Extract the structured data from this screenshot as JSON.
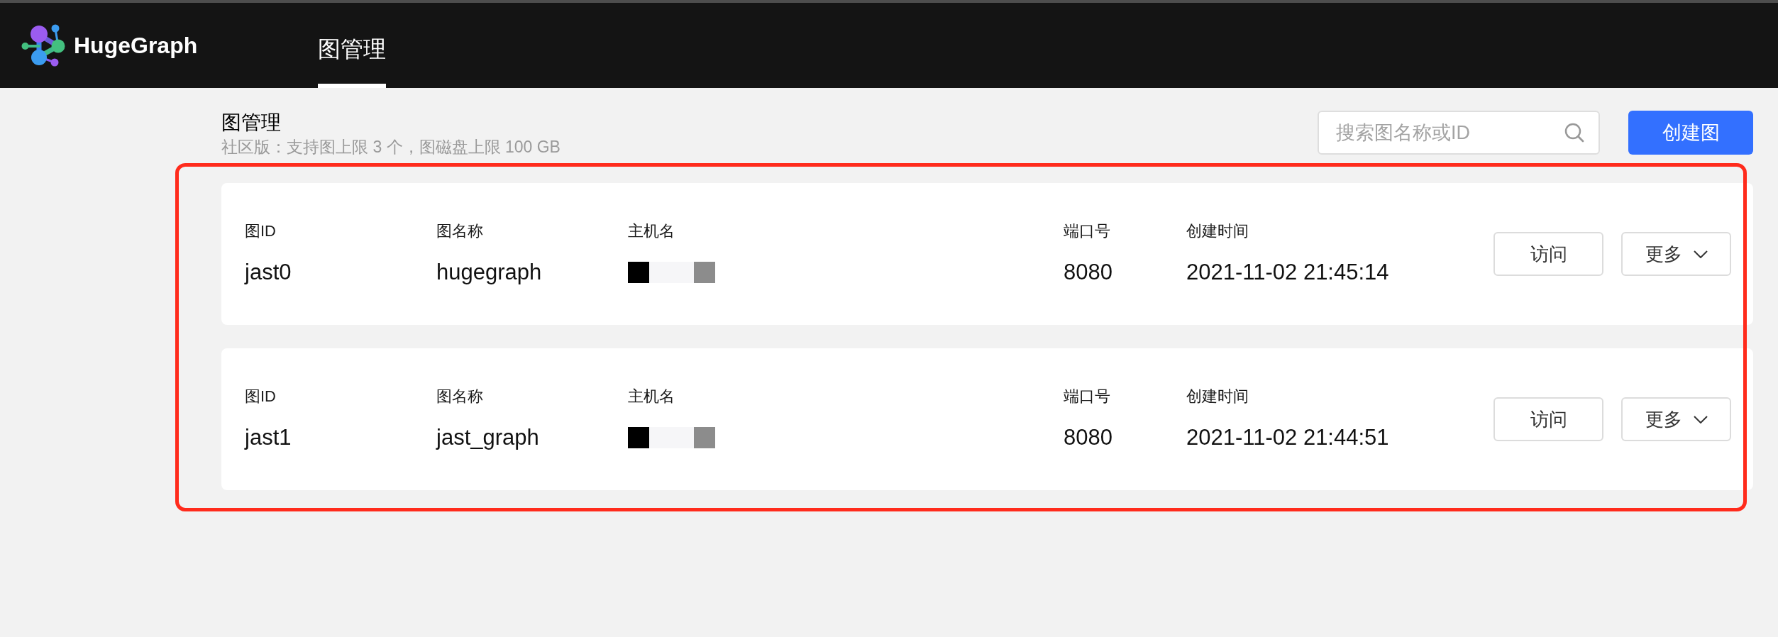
{
  "header": {
    "logo": "HugeGraph",
    "tabs": [
      {
        "label": "图管理",
        "selected": true
      }
    ]
  },
  "page": {
    "title": "图管理",
    "subtitle": "社区版：支持图上限 3 个，图磁盘上限 100 GB",
    "search": {
      "placeholder": "搜索图名称或ID"
    },
    "create_button": "创建图"
  },
  "graphs": [
    {
      "fields": [
        {
          "kind": "text",
          "label": "图ID",
          "value": "jast0"
        },
        {
          "kind": "text",
          "label": "图名称",
          "value": "hugegraph"
        },
        {
          "kind": "redacted",
          "label": "主机名"
        },
        {
          "kind": "text",
          "label": "端口号",
          "value": "8080"
        },
        {
          "kind": "text",
          "label": "创建时间",
          "value": "2021-11-02 21:45:14"
        }
      ],
      "actions": [
        {
          "kind": "button",
          "label": "访问"
        },
        {
          "kind": "dropdown",
          "label": "更多"
        }
      ]
    },
    {
      "fields": [
        {
          "kind": "text",
          "label": "图ID",
          "value": "jast1"
        },
        {
          "kind": "text",
          "label": "图名称",
          "value": "jast_graph"
        },
        {
          "kind": "redacted",
          "label": "主机名"
        },
        {
          "kind": "text",
          "label": "端口号",
          "value": "8080"
        },
        {
          "kind": "text",
          "label": "创建时间",
          "value": "2021-11-02 21:44:51"
        }
      ],
      "actions": [
        {
          "kind": "button",
          "label": "访问"
        },
        {
          "kind": "dropdown",
          "label": "更多"
        }
      ]
    }
  ]
}
